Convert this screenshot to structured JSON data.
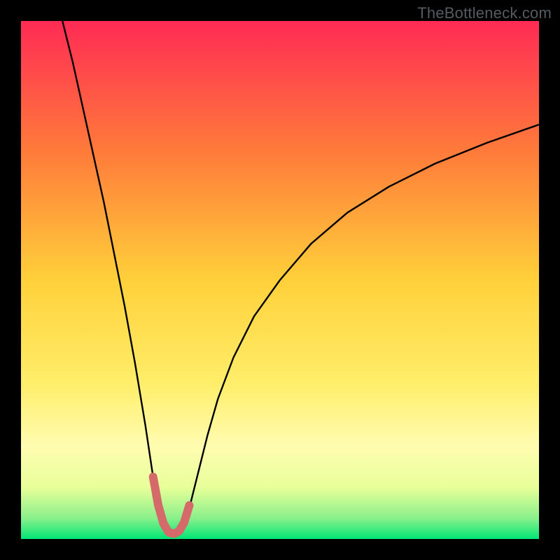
{
  "watermark": "TheBottleneck.com",
  "chart_data": {
    "type": "line",
    "title": "",
    "xlabel": "",
    "ylabel": "",
    "xlim": [
      0,
      100
    ],
    "ylim": [
      0,
      100
    ],
    "grid": false,
    "legend": false,
    "background_gradient": {
      "stops": [
        {
          "offset": 0.0,
          "color": "#ff2b55"
        },
        {
          "offset": 0.25,
          "color": "#ff7a3a"
        },
        {
          "offset": 0.5,
          "color": "#ffd03a"
        },
        {
          "offset": 0.7,
          "color": "#ffee6a"
        },
        {
          "offset": 0.82,
          "color": "#fffcb0"
        },
        {
          "offset": 0.9,
          "color": "#e8ff9a"
        },
        {
          "offset": 0.96,
          "color": "#8af08a"
        },
        {
          "offset": 1.0,
          "color": "#00e676"
        }
      ]
    },
    "series": [
      {
        "name": "curve",
        "color": "#000000",
        "stroke_width": 2.4,
        "x": [
          8.0,
          10.0,
          12.0,
          14.0,
          16.0,
          18.0,
          20.0,
          22.0,
          24.0,
          25.5,
          27.0,
          28.5,
          30.0,
          31.0,
          32.0,
          33.0,
          34.5,
          36.0,
          38.0,
          41.0,
          45.0,
          50.0,
          56.0,
          63.0,
          71.0,
          80.0,
          90.0,
          100.0
        ],
        "y": [
          100.0,
          92.0,
          83.0,
          74.0,
          65.0,
          55.0,
          45.0,
          34.0,
          22.0,
          12.0,
          5.0,
          1.5,
          1.0,
          1.5,
          4.0,
          8.0,
          14.0,
          20.0,
          27.0,
          35.0,
          43.0,
          50.0,
          57.0,
          63.0,
          68.0,
          72.5,
          76.5,
          80.0
        ]
      },
      {
        "name": "highlight-segment",
        "color": "#d46a6a",
        "stroke_width": 12,
        "linecap": "round",
        "x": [
          25.5,
          26.5,
          27.5,
          28.5,
          29.5,
          30.5,
          31.5,
          32.5
        ],
        "y": [
          12.0,
          6.5,
          3.0,
          1.3,
          1.0,
          1.5,
          3.2,
          6.5
        ]
      }
    ]
  }
}
